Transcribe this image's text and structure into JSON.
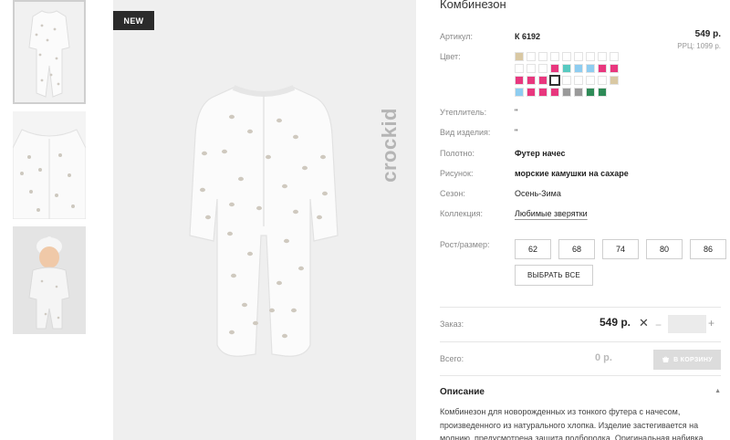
{
  "product": {
    "title": "Комбинезон",
    "badge": "NEW",
    "brand": "crockid",
    "price": "549 р.",
    "rrp": "РРЦ: 1099 р."
  },
  "attributes": {
    "article_label": "Артикул:",
    "article_value": "К 6192",
    "color_label": "Цвет:",
    "insulation_label": "Утеплитель:",
    "insulation_value": "\"",
    "type_label": "Вид изделия:",
    "type_value": "\"",
    "fabric_label": "Полотно:",
    "fabric_value": "Футер начес",
    "pattern_label": "Рисунок:",
    "pattern_value": "морские камушки на сахаре",
    "season_label": "Сезон:",
    "season_value": "Осень-Зима",
    "collection_label": "Коллекция:",
    "collection_value": "Любимые зверятки"
  },
  "swatch_colors": [
    "#d9c8a3",
    "#ffffff",
    "#ffffff",
    "#ffffff",
    "#ffffff",
    "#ffffff",
    "#ffffff",
    "#ffffff",
    "#ffffff",
    "#ffffff",
    "#ffffff",
    "#ffffff",
    "#e8377e",
    "#57c9c0",
    "#8ecdf0",
    "#8ecdf0",
    "#e8377e",
    "#e8377e",
    "#e8377e",
    "#e8377e",
    "#e8377e",
    "#ffffff",
    "#ffffff",
    "#ffffff",
    "#ffffff",
    "#ffffff",
    "#d9c8a3",
    "#8ecdf0",
    "#e8377e",
    "#e8377e",
    "#e8377e",
    "#9a9a9a",
    "#9a9a9a",
    "#2e8b57",
    "#2e8b57"
  ],
  "swatch_selected_index": 21,
  "sizes": {
    "label": "Рост/размер:",
    "options": [
      "62",
      "68",
      "74",
      "80",
      "86"
    ],
    "select_all": "ВЫБРАТЬ ВСЕ"
  },
  "order": {
    "label": "Заказ:",
    "price": "549 р.",
    "times": "✕",
    "minus": "−",
    "plus": "+",
    "qty_value": ""
  },
  "total": {
    "label": "Всего:",
    "value": "0 р.",
    "cart_button": "В КОРЗИНУ"
  },
  "description": {
    "title": "Описание",
    "text": "Комбинезон для новорожденных из тонкого футера с начесом, произведенного из натурального хлопка. Изделие застегивается на молнию, предусмотрена защита подбородка. Оригинальная набивка"
  },
  "colors": {
    "accent_pink": "#e8377e",
    "button_disabled": "#dcdcdc",
    "badge_bg": "#2b2b2b"
  }
}
